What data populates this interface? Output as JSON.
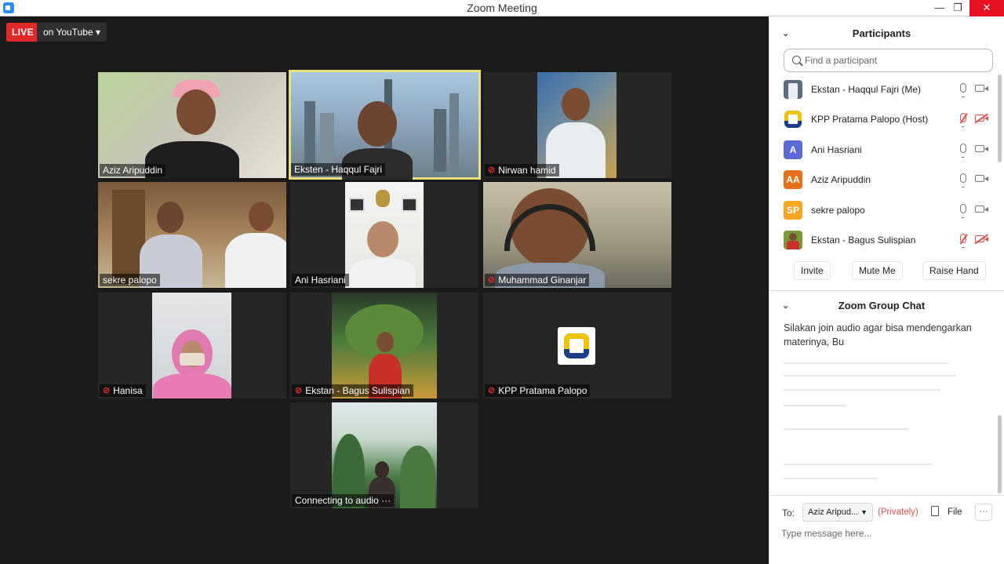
{
  "window": {
    "title": "Zoom Meeting",
    "minimize": "—",
    "maximize": "❐",
    "close": "✕"
  },
  "live": {
    "badge": "LIVE",
    "destination": "on YouTube",
    "arrow": "▾"
  },
  "tiles": [
    {
      "name": "Aziz Aripuddin",
      "muted": false
    },
    {
      "name": " Eksten - Haqqul Fajri",
      "muted": false,
      "active": true
    },
    {
      "name": "Nirwan hamid",
      "muted": true
    },
    {
      "name": "sekre palopo",
      "muted": false
    },
    {
      "name": "Ani Hasriani",
      "muted": false
    },
    {
      "name": "Muhammad Ginanjar",
      "muted": true
    },
    {
      "name": "Hanisa",
      "muted": true
    },
    {
      "name": "Ekstan - Bagus Sulispian",
      "muted": true
    },
    {
      "name": "KPP Pratama Palopo",
      "muted": true
    },
    {
      "name": "Connecting to audio ···",
      "muted": false
    }
  ],
  "participants": {
    "title": "Participants",
    "search_placeholder": "Find a participant",
    "list": [
      {
        "name": "Ekstan - Haqqul Fajri (Me)",
        "avatar": "",
        "avatar_color": "#5b6b80",
        "mic_off": false,
        "cam_off": false
      },
      {
        "name": "KPP Pratama Palopo (Host)",
        "avatar": "",
        "avatar_color": "#f2c300",
        "mic_off": true,
        "cam_off": true
      },
      {
        "name": "Ani Hasriani",
        "avatar": "A",
        "avatar_color": "#5b6ad6",
        "mic_off": false,
        "cam_off": false
      },
      {
        "name": "Aziz Aripuddin",
        "avatar": "AA",
        "avatar_color": "#e8701a",
        "mic_off": false,
        "cam_off": false
      },
      {
        "name": "sekre palopo",
        "avatar": "SP",
        "avatar_color": "#f5a623",
        "mic_off": false,
        "cam_off": false
      },
      {
        "name": "Ekstan - Bagus Sulispian",
        "avatar": "",
        "avatar_color": "#7a9a3a",
        "mic_off": true,
        "cam_off": true
      }
    ],
    "buttons": {
      "invite": "Invite",
      "mute_me": "Mute Me",
      "raise_hand": "Raise Hand"
    }
  },
  "chat": {
    "title": "Zoom Group Chat",
    "message": "Silakan join audio agar bisa mendengarkan materinya, Bu",
    "to_label": "To:",
    "to_value": "Aziz Aripud...",
    "privately": "(Privately)",
    "file": "File",
    "more": "···",
    "placeholder": "Type message here..."
  },
  "colors": {
    "accent": "#2d8cff",
    "live": "#e02828",
    "active_speaker": "#e8e07a",
    "muted": "#d9534f"
  }
}
